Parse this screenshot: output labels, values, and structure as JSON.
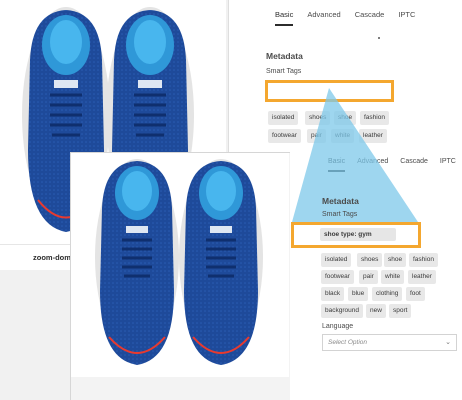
{
  "back": {
    "caption": "zoom-domi",
    "tabs": [
      "Basic",
      "Advanced",
      "Cascade",
      "IPTC"
    ],
    "active_tab": "Basic",
    "metadata_title": "Metadata",
    "smart_tags_label": "Smart Tags",
    "tags": [
      "isolated",
      "shoes",
      "shoe",
      "fashion",
      "footwear",
      "pair",
      "white",
      "leather"
    ]
  },
  "front": {
    "tabs": [
      "Basic",
      "Advanced",
      "Cascade",
      "IPTC"
    ],
    "active_tab": "Basic",
    "metadata_title": "Metadata",
    "smart_tags_label": "Smart Tags",
    "smart_tag_value": "shoe type: gym",
    "tags": [
      "isolated",
      "shoes",
      "shoe",
      "fashion",
      "footwear",
      "pair",
      "white",
      "leather",
      "black",
      "blue",
      "clothing",
      "foot",
      "background",
      "new",
      "sport"
    ],
    "language_label": "Language",
    "language_placeholder": "Select Option"
  },
  "colors": {
    "highlight": "#f4a72f",
    "funnel": "#7ec8ea",
    "shoe_blue": "#1e4a9a",
    "insole": "#3aa8e0"
  }
}
